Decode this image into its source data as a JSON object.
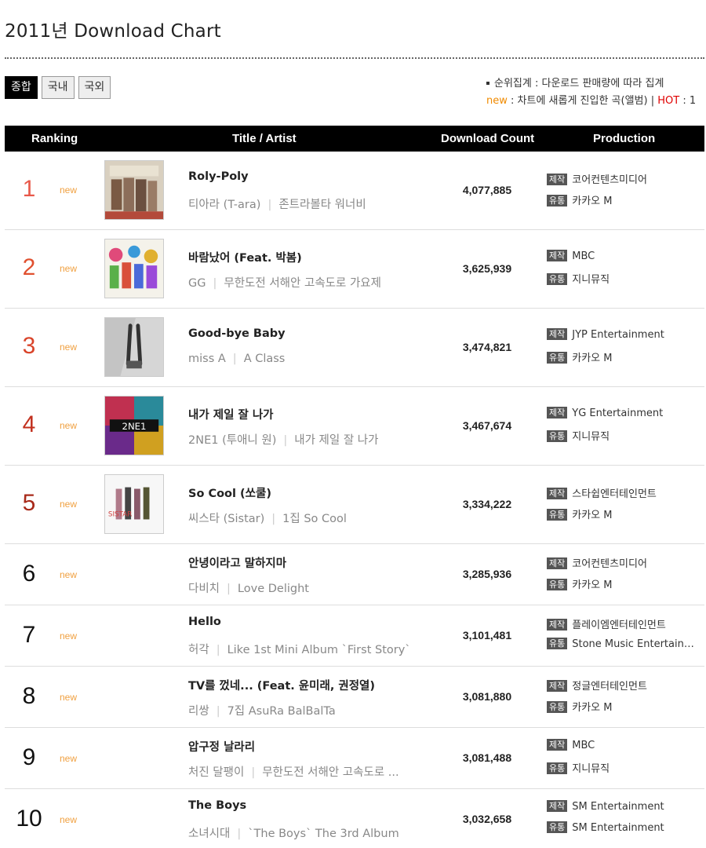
{
  "page_title": "2011년 Download Chart",
  "tabs": [
    "종합",
    "국내",
    "국외"
  ],
  "notes": {
    "line1": "순위집계 : 다운로드 판매량에 따라 집계",
    "new_word": "new",
    "new_desc": " : 차트에 새롭게 진입한 곡(앨범) | ",
    "hot_word": "HOT",
    "hot_desc": " : 1"
  },
  "header": {
    "ranking": "Ranking",
    "title_artist": "Title / Artist",
    "download_count": "Download Count",
    "production": "Production"
  },
  "badges": {
    "maker": "제작",
    "distributor": "유통"
  },
  "new_label": "new",
  "rows": [
    {
      "rank": "1",
      "title": "Roly-Poly",
      "artist": "티아라 (T-ara)",
      "album": "존트라볼타 워너비",
      "count": "4,077,885",
      "maker": "코어컨텐츠미디어",
      "distributor": "카카오 M"
    },
    {
      "rank": "2",
      "title": "바람났어 (Feat. 박봄)",
      "artist": "GG",
      "album": "무한도전 서해안 고속도로 가요제",
      "count": "3,625,939",
      "maker": "MBC",
      "distributor": "지니뮤직"
    },
    {
      "rank": "3",
      "title": "Good-bye Baby",
      "artist": "miss A",
      "album": "A Class",
      "count": "3,474,821",
      "maker": "JYP Entertainment",
      "distributor": "카카오 M"
    },
    {
      "rank": "4",
      "title": "내가 제일 잘 나가",
      "artist": "2NE1 (투애니 원)",
      "album": "내가 제일 잘 나가",
      "count": "3,467,674",
      "maker": "YG Entertainment",
      "distributor": "지니뮤직"
    },
    {
      "rank": "5",
      "title": "So Cool (쏘쿨)",
      "artist": "씨스타 (Sistar)",
      "album": "1집 So Cool",
      "count": "3,334,222",
      "maker": "스타쉽엔터테인먼트",
      "distributor": "카카오 M"
    },
    {
      "rank": "6",
      "title": "안녕이라고 말하지마",
      "artist": "다비치",
      "album": "Love Delight",
      "count": "3,285,936",
      "maker": "코어컨텐츠미디어",
      "distributor": "카카오 M"
    },
    {
      "rank": "7",
      "title": "Hello",
      "artist": "허각",
      "album": "Like 1st Mini Album `First Story`",
      "count": "3,101,481",
      "maker": "플레이엠엔터테인먼트",
      "distributor": "Stone Music Entertainm…"
    },
    {
      "rank": "8",
      "title": "TV를 껐네... (Feat. 윤미래, 권정열)",
      "artist": "리쌍",
      "album": "7집 AsuRa BalBalTa",
      "count": "3,081,880",
      "maker": "정글엔터테인먼트",
      "distributor": "카카오 M"
    },
    {
      "rank": "9",
      "title": "압구정 날라리",
      "artist": "처진 달팽이",
      "album": "무한도전 서해안 고속도로 ...",
      "count": "3,081,488",
      "maker": "MBC",
      "distributor": "지니뮤직"
    },
    {
      "rank": "10",
      "title": "The Boys",
      "artist": "소녀시대",
      "album": "`The Boys` The 3rd Album",
      "count": "3,032,658",
      "maker": "SM Entertainment",
      "distributor": "SM Entertainment"
    }
  ]
}
